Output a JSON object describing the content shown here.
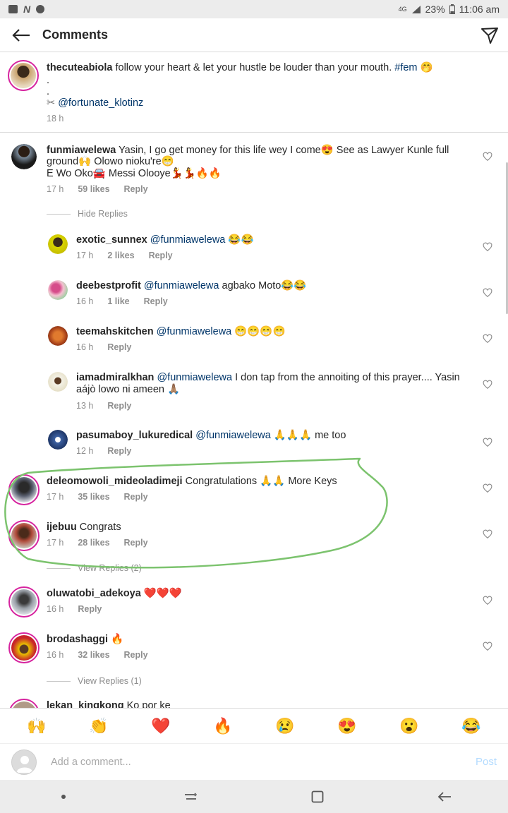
{
  "status_bar": {
    "network": "4G",
    "battery": "23%",
    "time": "11:06 am"
  },
  "header": {
    "title": "Comments"
  },
  "caption": {
    "username": "thecuteabiola",
    "text": " follow your heart & let your hustle be louder than your mouth. ",
    "hashtag": "#fem",
    "emoji": "🤭",
    "dot1": ".",
    "dot2": ".",
    "credit_icon": "✂",
    "credit": "@fortunate_klotinz",
    "time": "18 h"
  },
  "comments": [
    {
      "username": "funmiawelewa",
      "line1": " Yasin, I go get money for this life wey I come😍 See as Lawyer Kunle full",
      "line2": "ground🙌 Olowo nioku're😁",
      "line3": "E Wo Oko🚘 Messi Olooye💃💃🔥🔥",
      "time": "17 h",
      "likes": "59 likes",
      "reply": "Reply",
      "hide_replies": "Hide Replies"
    },
    {
      "username": "exotic_sunnex",
      "mention": " @funmiawelewa",
      "text": " 😂😂",
      "time": "17 h",
      "likes": "2 likes",
      "reply": "Reply"
    },
    {
      "username": "deebestprofit",
      "mention": " @funmiawelewa",
      "text": " agbako Moto😂😂",
      "time": "16 h",
      "likes": "1 like",
      "reply": "Reply"
    },
    {
      "username": "teemahskitchen",
      "mention": " @funmiawelewa",
      "text": " 😁😁😁😁",
      "time": "16 h",
      "reply": "Reply"
    },
    {
      "username": "iamadmiralkhan",
      "mention": " @funmiawelewa",
      "text": " I don tap from the annoiting of this prayer.... Yasin",
      "line2": "aájò lowo ni ameen 🙏🏽",
      "time": "13 h",
      "reply": "Reply"
    },
    {
      "username": "pasumaboy_lukuredical",
      "mention": " @funmiawelewa",
      "text": " 🙏🙏🙏 me too",
      "time": "12 h",
      "reply": "Reply"
    },
    {
      "username": "deleomowoli_mideoladimeji",
      "text": " Congratulations 🙏🙏 More Keys",
      "time": "17 h",
      "likes": "35 likes",
      "reply": "Reply"
    },
    {
      "username": "ijebuu",
      "text": " Congrats",
      "time": "17 h",
      "likes": "28 likes",
      "reply": "Reply",
      "view_replies": "View Replies (2)"
    },
    {
      "username": "oluwatobi_adekoya",
      "text": " ❤️❤️❤️",
      "time": "16 h",
      "reply": "Reply"
    },
    {
      "username": "brodashaggi",
      "text": " 🔥",
      "time": "16 h",
      "likes": "32 likes",
      "reply": "Reply",
      "view_replies": "View Replies (1)"
    },
    {
      "username": "lekan_kingkong",
      "text": " Ko por ke"
    }
  ],
  "emoji_bar": [
    "🙌",
    "👏",
    "❤️",
    "🔥",
    "😢",
    "😍",
    "😮",
    "😂"
  ],
  "composer": {
    "placeholder": "Add a comment...",
    "post": "Post"
  },
  "colors": {
    "link": "#003569",
    "meta": "#8e8e8e",
    "highlight": "#7cc36e"
  }
}
